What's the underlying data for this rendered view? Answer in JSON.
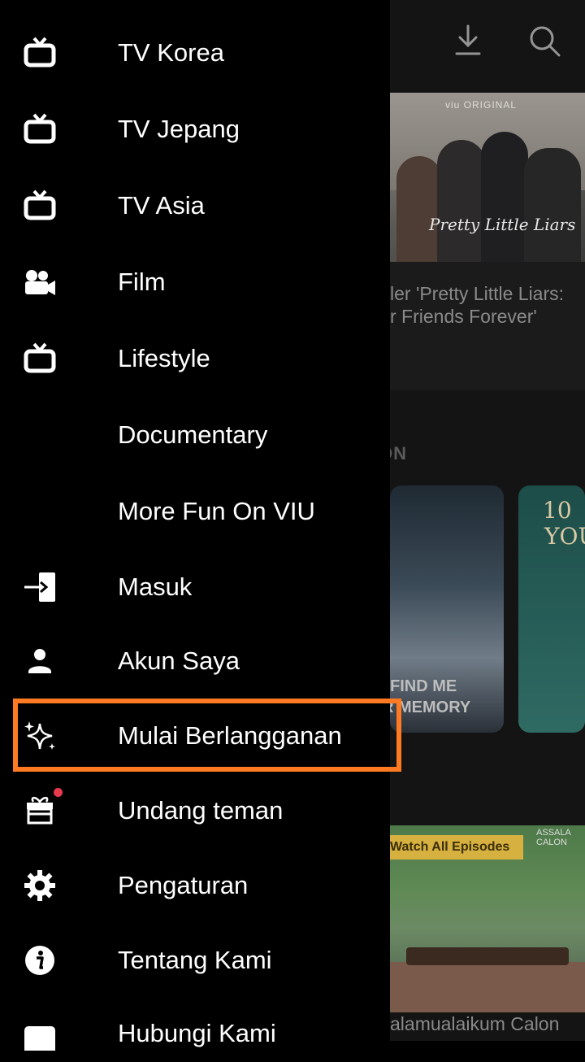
{
  "toolbar": {
    "icons": [
      "download-icon",
      "search-icon"
    ]
  },
  "drawer": {
    "items": [
      {
        "label": "TV Korea",
        "icon": "tv-icon"
      },
      {
        "label": "TV Jepang",
        "icon": "tv-icon"
      },
      {
        "label": "TV Asia",
        "icon": "tv-icon"
      },
      {
        "label": "Film",
        "icon": "video-camera-icon"
      },
      {
        "label": "Lifestyle",
        "icon": "tv-icon"
      },
      {
        "label": "Documentary",
        "icon": ""
      },
      {
        "label": "More Fun On VIU",
        "icon": ""
      },
      {
        "label": "Masuk",
        "icon": "sign-in-icon"
      },
      {
        "label": "Akun Saya",
        "icon": "person-icon"
      },
      {
        "label": "Mulai Berlangganan",
        "icon": "sparkles-icon"
      },
      {
        "label": "Undang teman",
        "icon": "gift-icon"
      },
      {
        "label": "Pengaturan",
        "icon": "gear-icon"
      },
      {
        "label": "Tentang Kami",
        "icon": "info-icon"
      },
      {
        "label": "Hubungi Kami",
        "icon": "contact-icon"
      }
    ],
    "highlight_color": "#ff7a22",
    "notification_color": "#e83a4f"
  },
  "background": {
    "hero": {
      "logo": "viu ORIGINAL",
      "script_title": "Pretty Little Liars",
      "caption_line1": "ler 'Pretty Little Liars:",
      "caption_line2": "r Friends Forever'"
    },
    "section_label": "ON",
    "poster1": {
      "line1": "FIND ME",
      "line2": "R MEMORY"
    },
    "poster2": {
      "line1": "10",
      "line2": "YOU"
    },
    "episode_badge": "Watch All Episodes",
    "episode_corner": "ASSALA CALON",
    "episode_title": "alamualaikum Calon"
  }
}
